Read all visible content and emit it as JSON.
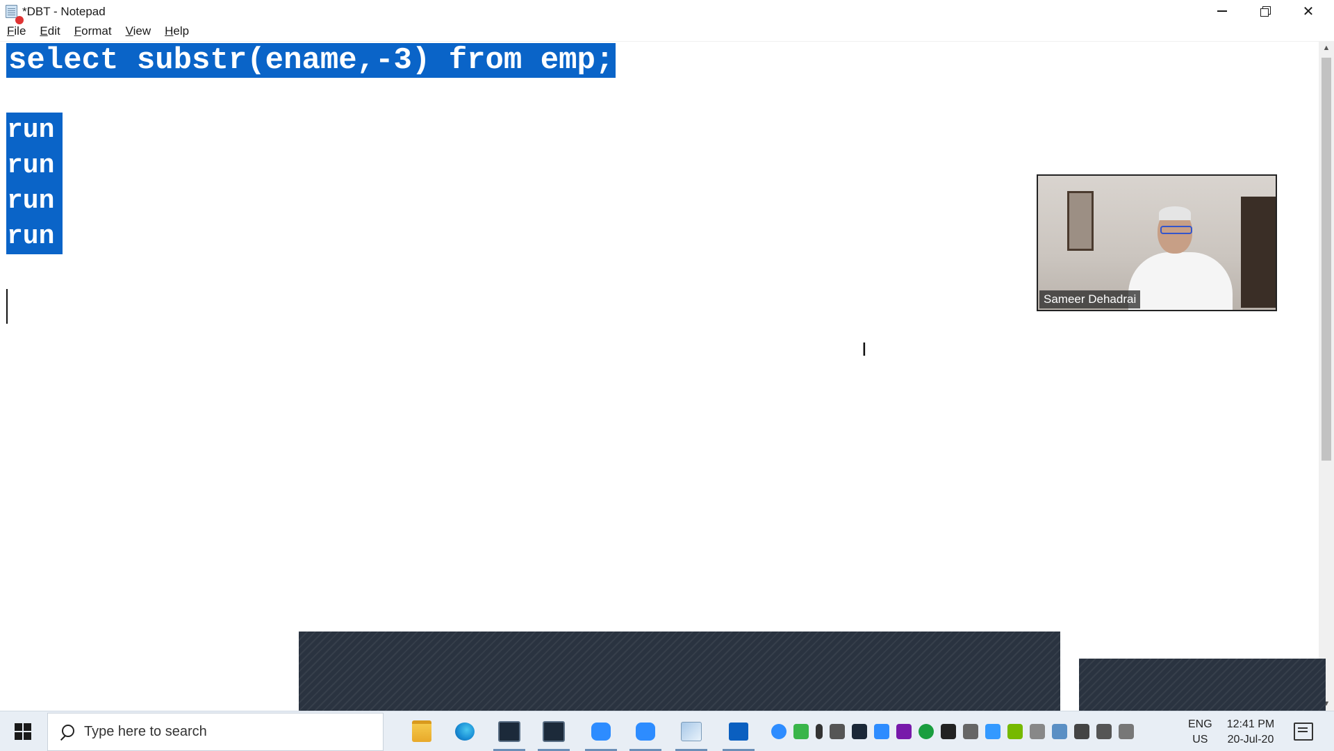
{
  "window": {
    "title": "*DBT - Notepad",
    "minimize_label": "minimize",
    "maximize_label": "restore",
    "close_label": "close"
  },
  "menu": {
    "items": [
      {
        "underline": "F",
        "rest": "ile"
      },
      {
        "underline": "E",
        "rest": "dit"
      },
      {
        "underline": "F",
        "rest": "ormat"
      },
      {
        "underline": "V",
        "rest": "iew"
      },
      {
        "underline": "H",
        "rest": "elp"
      }
    ]
  },
  "editor": {
    "line1": "select substr(ename,-3) from emp;",
    "run_lines": [
      "run",
      "run",
      "run",
      "run"
    ],
    "selection_color": "#0a64c8"
  },
  "video": {
    "participant_name": "Sameer Dehadrai"
  },
  "taskbar": {
    "search_placeholder": "Type here to search",
    "apps": [
      "file-explorer-icon",
      "edge-icon",
      "terminal-icon",
      "terminal-icon",
      "zoom-icon",
      "zoom-icon",
      "notepad-icon",
      "wave-app-icon"
    ],
    "lang_top": "ENG",
    "lang_bottom": "US",
    "time": "12:41 PM",
    "date": "20-Jul-20"
  }
}
